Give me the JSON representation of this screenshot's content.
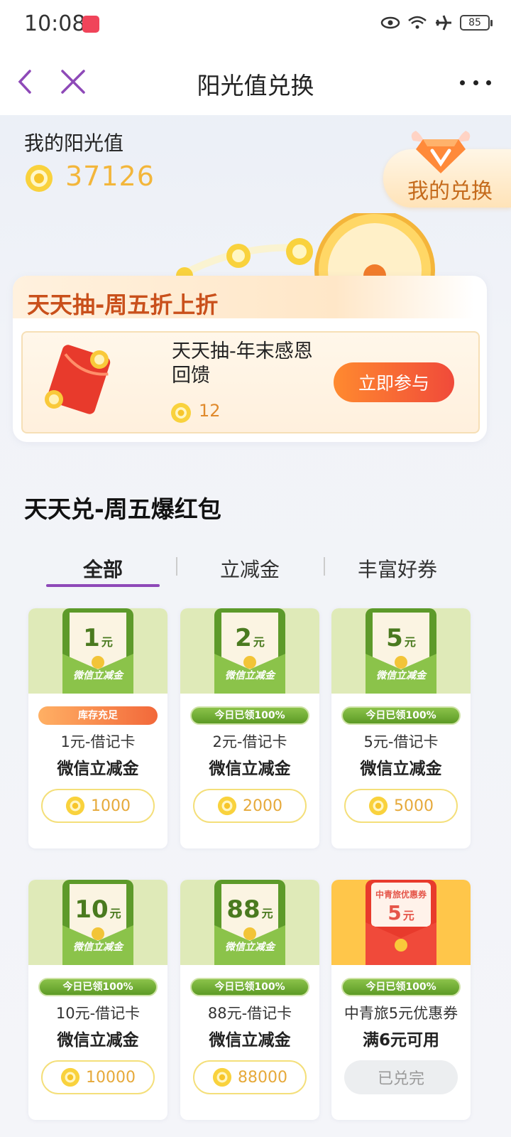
{
  "status_bar": {
    "time": "10:08",
    "battery": "85"
  },
  "nav": {
    "title": "阳光值兑换"
  },
  "sunshine": {
    "label": "我的阳光值",
    "value": "37126"
  },
  "my_exchange": {
    "label": "我的兑换"
  },
  "lottery": {
    "title": "天天抽-周五折上折",
    "item_title": "天天抽-年末感恩回馈",
    "cost": "12",
    "join_label": "立即参与"
  },
  "section": {
    "title": "天天兑-周五爆红包",
    "tabs": [
      {
        "label": "全部",
        "active": true
      },
      {
        "label": "立减金",
        "active": false
      },
      {
        "label": "丰富好券",
        "active": false
      }
    ]
  },
  "cards": [
    {
      "amount": "1",
      "unit": "元",
      "sub": "微信立减金",
      "badge": "库存充足",
      "line1": "1元-借记卡",
      "line2": "微信立减金",
      "price": "1000"
    },
    {
      "amount": "2",
      "unit": "元",
      "sub": "微信立减金",
      "badge": "今日已领100%",
      "line1": "2元-借记卡",
      "line2": "微信立减金",
      "price": "2000"
    },
    {
      "amount": "5",
      "unit": "元",
      "sub": "微信立减金",
      "badge": "今日已领100%",
      "line1": "5元-借记卡",
      "line2": "微信立减金",
      "price": "5000"
    },
    {
      "amount": "10",
      "unit": "元",
      "sub": "微信立减金",
      "badge": "今日已领100%",
      "line1": "10元-借记卡",
      "line2": "微信立减金",
      "price": "10000"
    },
    {
      "amount": "88",
      "unit": "元",
      "sub": "微信立减金",
      "badge": "今日已领100%",
      "line1": "88元-借记卡",
      "line2": "微信立减金",
      "price": "88000"
    },
    {
      "amount": "5",
      "unit": "元",
      "sub": "中青旅优惠券",
      "badge": "今日已领100%",
      "line1": "中青旅5元优惠券",
      "line2": "满6元可用",
      "price": "已兑完"
    }
  ],
  "colors": {
    "accent_purple": "#8e49b8",
    "coin_gold": "#f3b63b",
    "lottery_orange": "#c9501b"
  }
}
